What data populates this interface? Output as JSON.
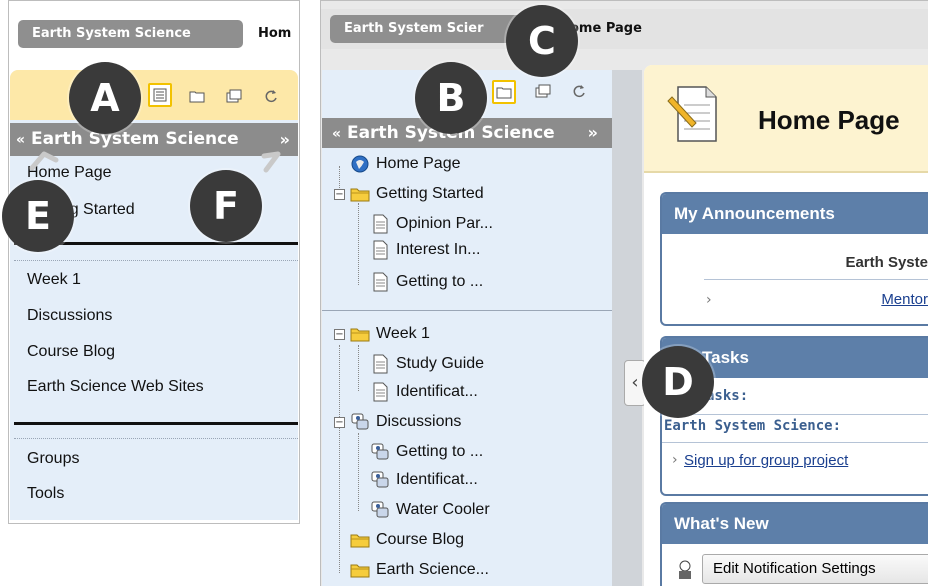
{
  "left": {
    "course_tab": "Earth System Science",
    "breadcrumb": "Hom",
    "menu_title": "Earth System Science",
    "items_top": [
      "Home Page",
      "Getting Started"
    ],
    "items_mid": [
      "Week 1",
      "Discussions",
      "Course Blog",
      "Earth Science Web Sites"
    ],
    "items_bottom": [
      "Groups",
      "Tools"
    ],
    "toolbar_icons": [
      "list-view-icon",
      "folder-view-icon",
      "new-window-icon",
      "refresh-icon"
    ]
  },
  "right": {
    "course_tab": "Earth System Scier",
    "breadcrumb": "ome Page",
    "menu_title": "Earth System Science",
    "tree": [
      {
        "label": "Home Page",
        "icon": "home-globe-icon"
      },
      {
        "label": "Getting Started",
        "icon": "folder-icon"
      },
      {
        "label": "Opinion Par...",
        "icon": "document-icon"
      },
      {
        "label": "Interest In...",
        "icon": "document-icon"
      },
      {
        "label": "Getting to ...",
        "icon": "document-icon"
      },
      {
        "label": "Week 1",
        "icon": "folder-icon"
      },
      {
        "label": "Study Guide",
        "icon": "document-icon"
      },
      {
        "label": "Identificat...",
        "icon": "document-icon"
      },
      {
        "label": "Discussions",
        "icon": "discussion-icon"
      },
      {
        "label": "Getting to ...",
        "icon": "discussion-icon"
      },
      {
        "label": "Identificat...",
        "icon": "discussion-icon"
      },
      {
        "label": "Water Cooler",
        "icon": "discussion-icon"
      },
      {
        "label": "Course Blog",
        "icon": "folder-icon"
      },
      {
        "label": "Earth Science...",
        "icon": "folder-icon"
      }
    ],
    "content": {
      "page_title": "Home Page",
      "announcements": {
        "title": "My Announcements",
        "course": "Earth Syste",
        "link": "Mentor"
      },
      "tasks": {
        "title": "Tasks",
        "subtitle": "asks:",
        "course": "Earth System Science:",
        "link": "Sign up for group project"
      },
      "whats_new": {
        "title": "What's New",
        "button": "Edit Notification Settings"
      }
    }
  },
  "callouts": [
    "A",
    "B",
    "C",
    "D",
    "E",
    "F"
  ],
  "colors": {
    "toolbar_yellow": "#fde8a8",
    "menu_blue": "#e4eef9",
    "header_gray": "#8c8c8c",
    "module_blue": "#5d7fa9",
    "callout_dark": "#3a3a3a"
  }
}
